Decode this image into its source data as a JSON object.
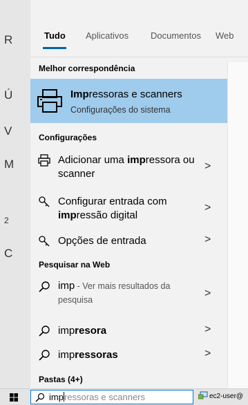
{
  "background": {
    "left_letters": [
      "R",
      "Ú",
      "V",
      "M",
      "2",
      "C"
    ]
  },
  "tabs": [
    {
      "label": "Tudo",
      "active": true
    },
    {
      "label": "Aplicativos",
      "active": false
    },
    {
      "label": "Documentos",
      "active": false
    },
    {
      "label": "Web",
      "active": false
    }
  ],
  "sections": {
    "best_match": "Melhor correspondência",
    "settings": "Configurações",
    "web": "Pesquisar na Web",
    "folders": "Pastas (4+)"
  },
  "best_match": {
    "title_bold": "Imp",
    "title_rest": "ressoras e scanners",
    "subtitle": "Configurações do sistema",
    "icon": "printer-icon"
  },
  "settings_items": [
    {
      "pre": "Adicionar uma ",
      "bold": "imp",
      "post": "ressora ou scanner",
      "icon": "printer-icon"
    },
    {
      "pre": "Configurar entrada com ",
      "bold": "imp",
      "post": "ressão digital",
      "icon": "fingerprint-key-icon"
    },
    {
      "pre": "Opções de entrada",
      "bold": "",
      "post": "",
      "icon": "key-icon"
    }
  ],
  "web_items": [
    {
      "main": "imp",
      "suffix": " - Ver mais resultados da pesquisa",
      "bold_tail": ""
    },
    {
      "main": "imp",
      "suffix": "",
      "bold_tail": "resora"
    },
    {
      "main": "imp",
      "suffix": "",
      "bold_tail": "ressoras"
    }
  ],
  "chevron": ">",
  "search": {
    "typed": "imp",
    "completion": "ressoras e scanners"
  },
  "tray": {
    "user": "ec2-user@"
  },
  "colors": {
    "accent": "#0078d4",
    "highlight": "#9fcbec"
  }
}
